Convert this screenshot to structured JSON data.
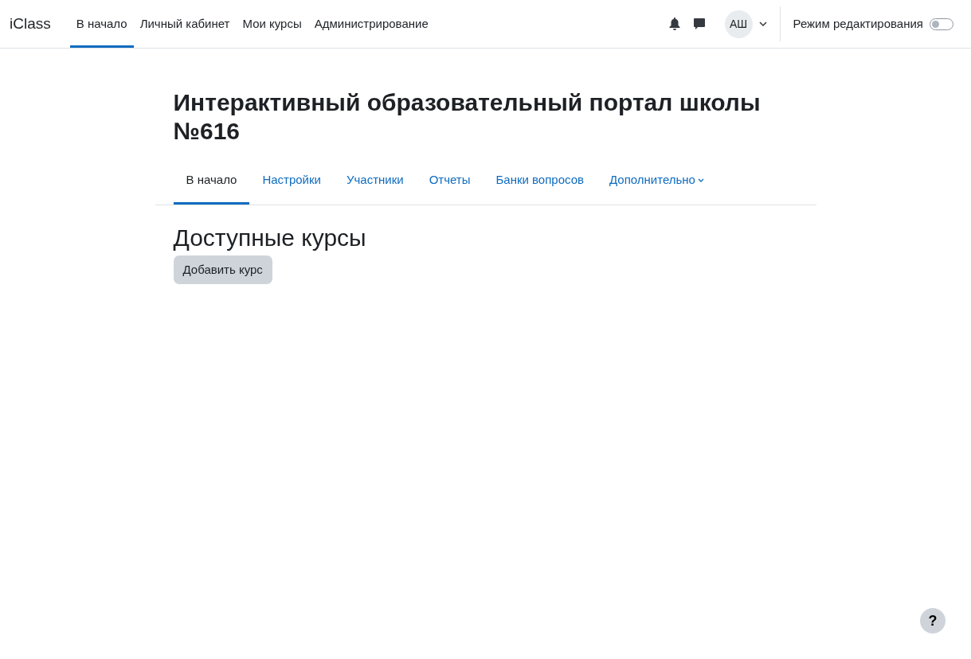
{
  "navbar": {
    "brand": "iClass",
    "items": [
      {
        "label": "В начало",
        "selected": true
      },
      {
        "label": "Личный кабинет",
        "selected": false
      },
      {
        "label": "Мои курсы",
        "selected": false
      },
      {
        "label": "Администрирование",
        "selected": false
      }
    ],
    "user_initials": "АШ",
    "edit_mode": {
      "label": "Режим редактирования",
      "on": false
    }
  },
  "page_title": "Интерактивный образовательный портал школы №616",
  "tabs": [
    {
      "label": "В начало",
      "selected": true,
      "dropdown": false
    },
    {
      "label": "Настройки",
      "selected": false,
      "dropdown": false
    },
    {
      "label": "Участники",
      "selected": false,
      "dropdown": false
    },
    {
      "label": "Отчеты",
      "selected": false,
      "dropdown": false
    },
    {
      "label": "Банки вопросов",
      "selected": false,
      "dropdown": false
    },
    {
      "label": "Дополнительно",
      "selected": false,
      "dropdown": true
    }
  ],
  "section_title": "Доступные курсы",
  "add_button": "Добавить курс",
  "help_button": "?"
}
